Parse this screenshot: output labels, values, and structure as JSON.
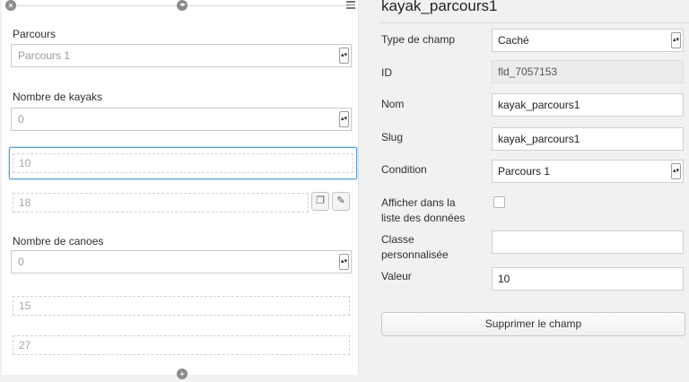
{
  "left_panel": {
    "parcours": {
      "label": "Parcours",
      "selected": "Parcours 1"
    },
    "kayaks": {
      "label": "Nombre de kayaks",
      "selected": "0",
      "values": [
        "10",
        "18"
      ]
    },
    "canoes": {
      "label": "Nombre de canoes",
      "selected": "0",
      "values": [
        "15",
        "27"
      ]
    },
    "icons": {
      "close": "×",
      "move": "◂▸",
      "add": "+",
      "copy": "❐",
      "edit": "✎"
    }
  },
  "field_settings": {
    "title": "kayak_parcours1",
    "type": {
      "label": "Type de champ",
      "value": "Caché"
    },
    "id": {
      "label": "ID",
      "value": "fld_7057153"
    },
    "name": {
      "label": "Nom",
      "value": "kayak_parcours1"
    },
    "slug": {
      "label": "Slug",
      "value": "kayak_parcours1"
    },
    "condition": {
      "label": "Condition",
      "value": "Parcours 1"
    },
    "show_in_list": {
      "label_line1": "Afficher dans la",
      "label_line2": "liste des données",
      "checked": false
    },
    "custom_class": {
      "label_line1": "Classe",
      "label_line2": "personnalisée",
      "value": ""
    },
    "value": {
      "label": "Valeur",
      "value": "10"
    },
    "delete_button": "Supprimer le champ",
    "select_arrow": "▴▾"
  }
}
